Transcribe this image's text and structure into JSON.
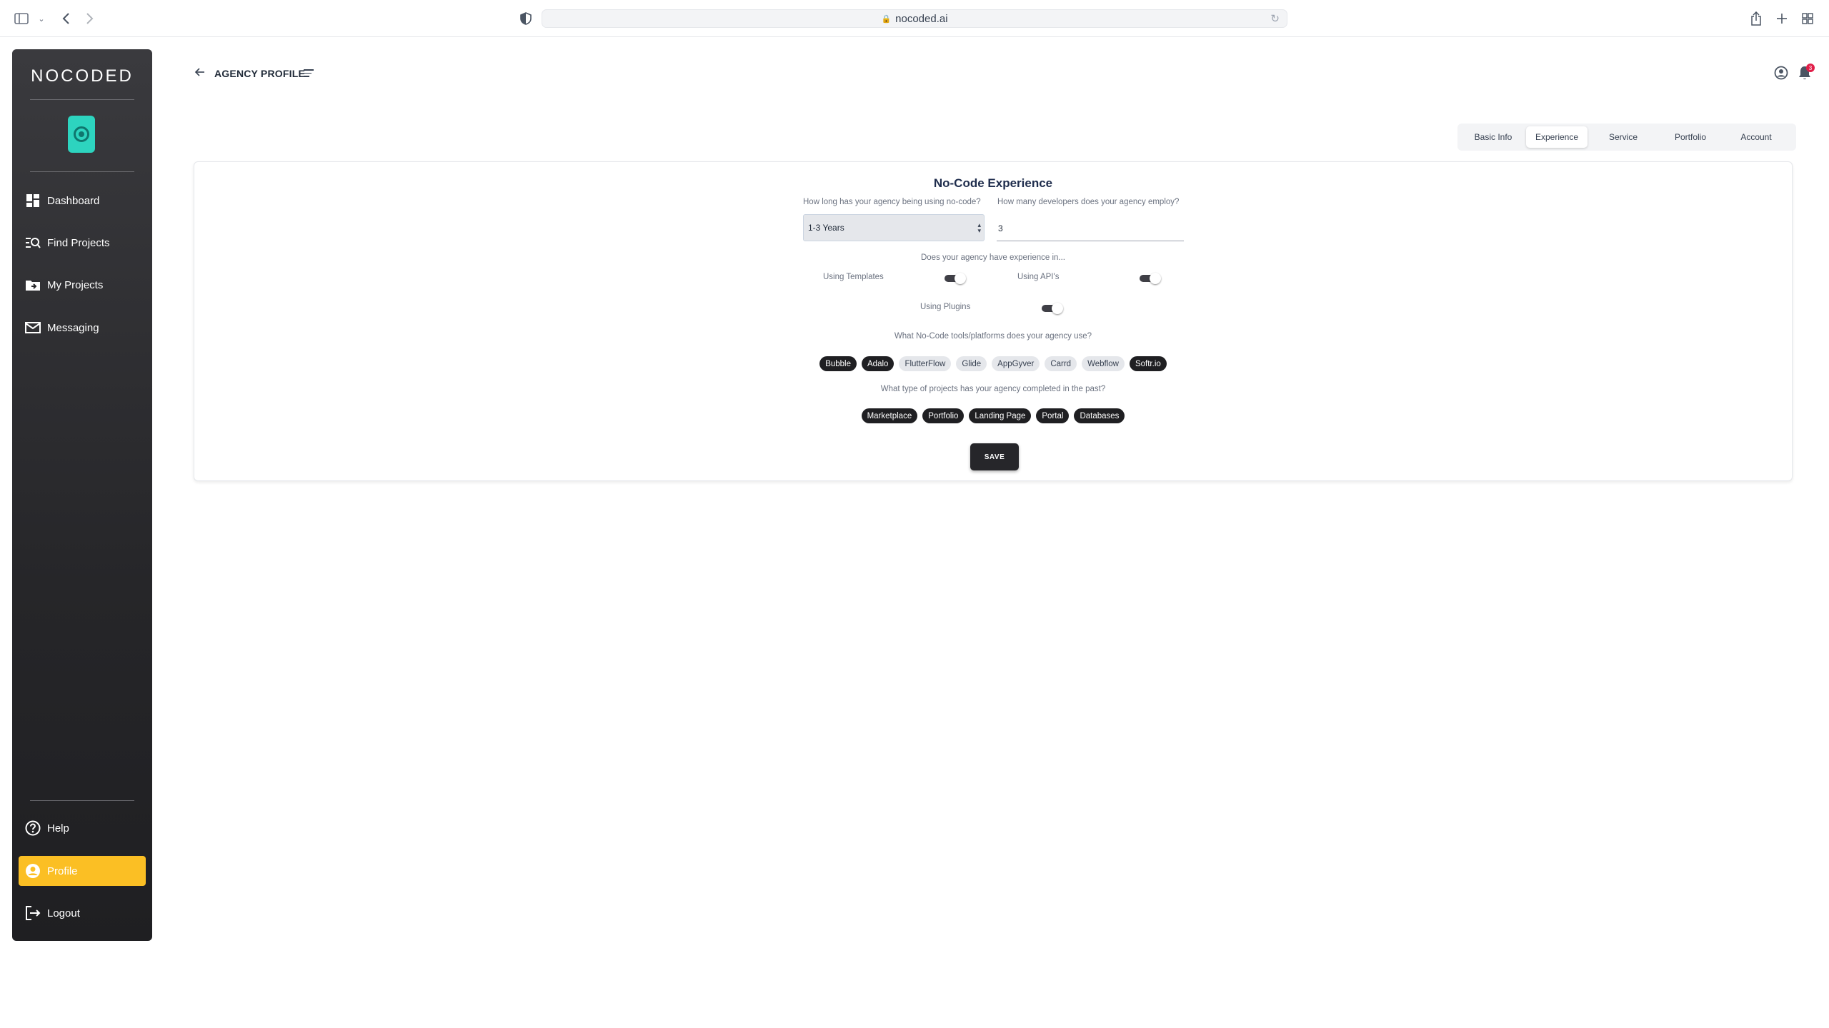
{
  "browser": {
    "url": "nocoded.ai",
    "icons": [
      "sidebar-toggle-icon",
      "chevron-down-icon",
      "back-icon",
      "forward-icon",
      "privacy-shield-icon",
      "lock-icon",
      "reload-icon",
      "share-icon",
      "new-tab-icon",
      "tab-overview-icon"
    ]
  },
  "sidebar": {
    "brand": "NOCODED",
    "items": [
      {
        "label": "Dashboard",
        "icon": "dashboard-icon"
      },
      {
        "label": "Find Projects",
        "icon": "find-projects-icon"
      },
      {
        "label": "My Projects",
        "icon": "my-projects-icon"
      },
      {
        "label": "Messaging",
        "icon": "messaging-icon"
      }
    ],
    "bottom_items": [
      {
        "label": "Help",
        "icon": "help-icon"
      },
      {
        "label": "Profile",
        "icon": "profile-icon",
        "active": true
      },
      {
        "label": "Logout",
        "icon": "logout-icon"
      }
    ],
    "accent_color": "#fbbf24"
  },
  "header": {
    "title": "AGENCY PROFILE",
    "notification_count": "3"
  },
  "tabs": [
    {
      "label": "Basic Info",
      "active": false
    },
    {
      "label": "Experience",
      "active": true
    },
    {
      "label": "Service",
      "active": false
    },
    {
      "label": "Portfolio",
      "active": false
    },
    {
      "label": "Account",
      "active": false
    }
  ],
  "form": {
    "title": "No-Code Experience",
    "years_label": "How long has your agency being using no-code?",
    "years_value": "1-3 Years",
    "developers_label": "How many developers does your agency employ?",
    "developers_value": "3",
    "experience_question": "Does your agency have experience in...",
    "toggles": [
      {
        "label": "Using Templates",
        "on": true
      },
      {
        "label": "Using API's",
        "on": true
      },
      {
        "label": "Using Plugins",
        "on": true
      }
    ],
    "tools_question": "What No-Code tools/platforms does your agency use?",
    "tools": [
      {
        "label": "Bubble",
        "selected": true
      },
      {
        "label": "Adalo",
        "selected": true
      },
      {
        "label": "FlutterFlow",
        "selected": false
      },
      {
        "label": "Glide",
        "selected": false
      },
      {
        "label": "AppGyver",
        "selected": false
      },
      {
        "label": "Carrd",
        "selected": false
      },
      {
        "label": "Webflow",
        "selected": false
      },
      {
        "label": "Softr.io",
        "selected": true
      }
    ],
    "projects_question": "What type of projects has your agency completed in the past?",
    "project_types": [
      {
        "label": "Marketplace",
        "selected": true
      },
      {
        "label": "Portfolio",
        "selected": true
      },
      {
        "label": "Landing Page",
        "selected": true
      },
      {
        "label": "Portal",
        "selected": true
      },
      {
        "label": "Databases",
        "selected": true
      }
    ],
    "save_label": "SAVE"
  }
}
